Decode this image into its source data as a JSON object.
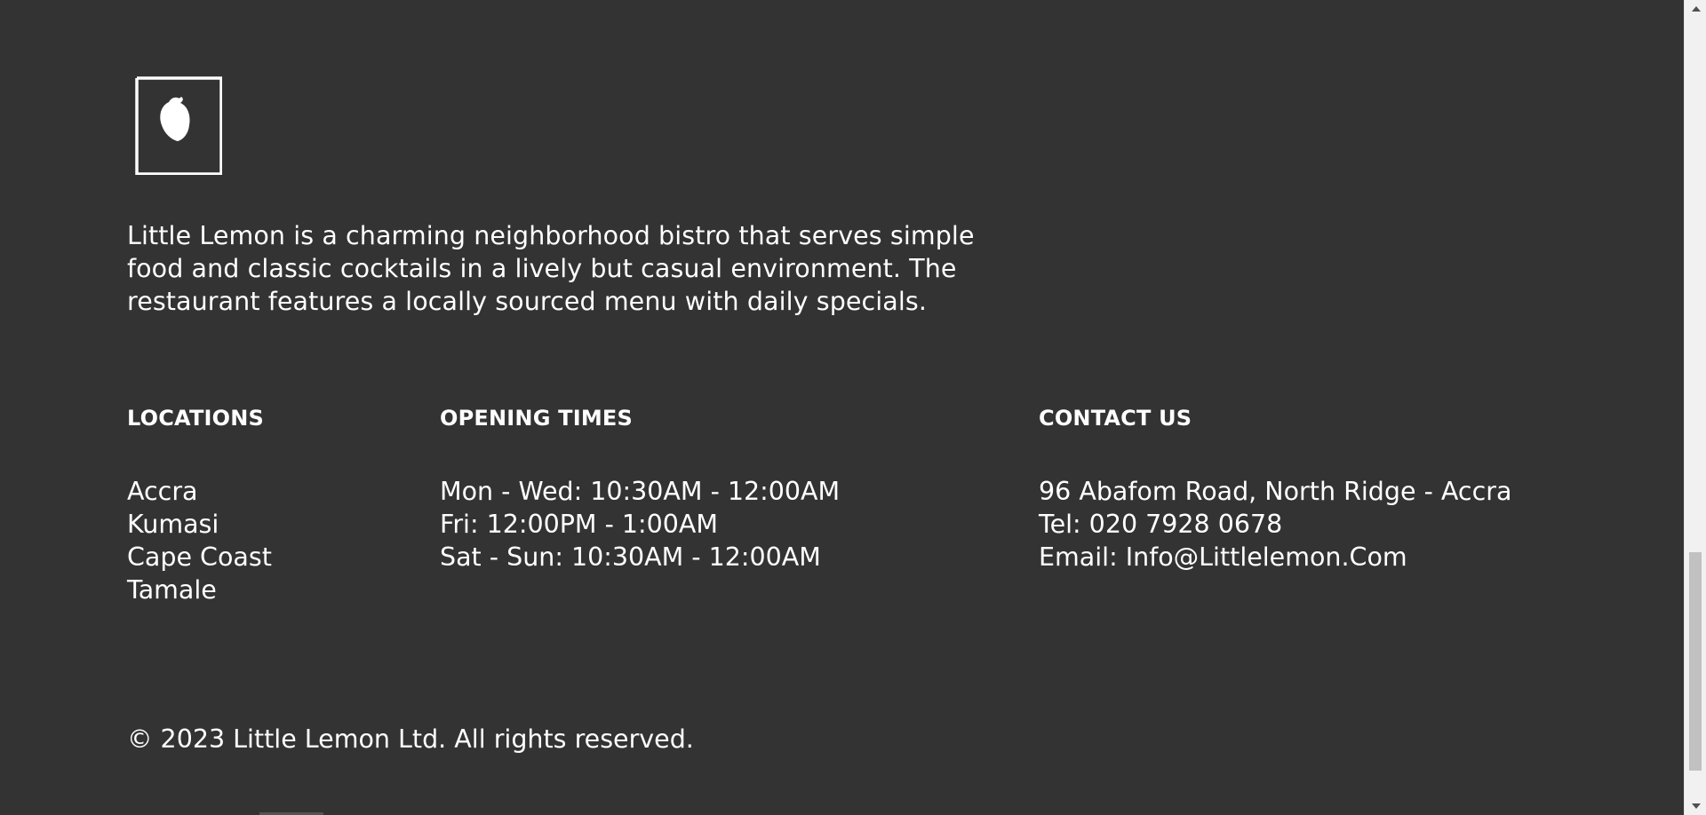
{
  "brand": {
    "logo_icon": "lemon-logo-icon"
  },
  "about": {
    "text": "Little Lemon is a charming neighborhood bistro that serves simple food and classic cocktails in a lively but casual environment. The restaurant features a locally sourced menu with daily specials."
  },
  "locations": {
    "heading": "LOCATIONS",
    "items": [
      "Accra",
      "Kumasi",
      "Cape Coast",
      "Tamale"
    ]
  },
  "opening_times": {
    "heading": "OPENING TIMES",
    "items": [
      "Mon - Wed: 10:30AM - 12:00AM",
      "Fri: 12:00PM - 1:00AM",
      "Sat - Sun: 10:30AM - 12:00AM"
    ]
  },
  "contact": {
    "heading": "CONTACT US",
    "items": [
      "96 Abafom Road, North Ridge - Accra",
      "Tel: 020 7928 0678",
      "Email: Info@Littlelemon.Com"
    ]
  },
  "copyright": "© 2023 Little Lemon Ltd. All rights reserved.",
  "colors": {
    "background": "#333333",
    "text": "#ffffff",
    "scrollbar_track": "#f1f1f1",
    "scrollbar_thumb": "#c1c1c1"
  }
}
